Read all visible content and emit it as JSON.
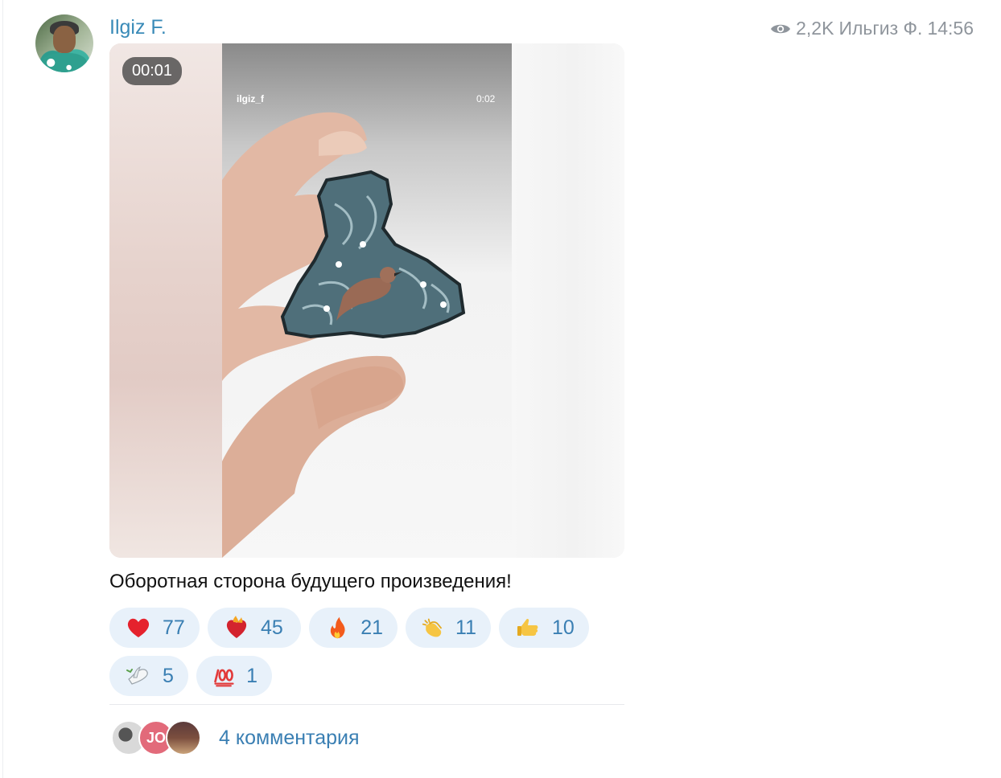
{
  "post": {
    "author": "Ilgiz F.",
    "views": "2,2K",
    "signature": "Ильгиз Ф.",
    "time": "14:56",
    "caption": "Оборотная сторона будущего произведения!"
  },
  "media": {
    "timecode": "00:01",
    "inner_username": "ilgiz_f",
    "inner_duration": "0:02"
  },
  "reactions": [
    {
      "emoji": "red-heart",
      "count": "77"
    },
    {
      "emoji": "heart-on-fire",
      "count": "45"
    },
    {
      "emoji": "fire",
      "count": "21"
    },
    {
      "emoji": "clapping-hands",
      "count": "11"
    },
    {
      "emoji": "thumbs-up",
      "count": "10"
    },
    {
      "emoji": "dove",
      "count": "5"
    },
    {
      "emoji": "hundred-points",
      "count": "1"
    }
  ],
  "comments": {
    "label": "4 комментария",
    "commenter_initials": "JO"
  },
  "colors": {
    "accent": "#3a8bb8",
    "reaction_bg": "#e8f1fa",
    "meta_gray": "#8f959c"
  }
}
